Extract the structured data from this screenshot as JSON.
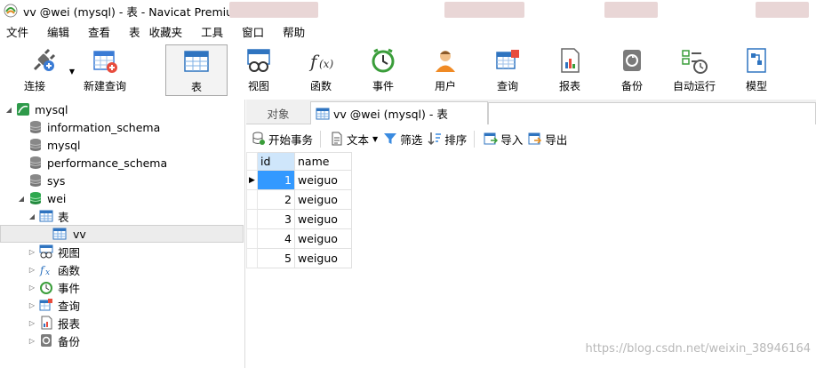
{
  "window": {
    "title": "vv @wei (mysql) - 表 - Navicat Premium"
  },
  "menu": [
    "文件",
    "编辑",
    "查看",
    "表",
    "收藏夹",
    "工具",
    "窗口",
    "帮助"
  ],
  "toolbar": {
    "connect": "连接",
    "new_query": "新建查询",
    "table": "表",
    "view": "视图",
    "function": "函数",
    "event": "事件",
    "user": "用户",
    "query": "查询",
    "report": "报表",
    "backup": "备份",
    "automation": "自动运行",
    "model": "模型"
  },
  "tree": {
    "connection": "mysql",
    "databases": [
      "information_schema",
      "mysql",
      "performance_schema",
      "sys"
    ],
    "active_db": "wei",
    "tables_node": "表",
    "table_item": "vv",
    "groups": [
      "视图",
      "函数",
      "事件",
      "查询",
      "报表",
      "备份"
    ]
  },
  "tabs": {
    "objects": "对象",
    "current": "vv @wei (mysql) - 表"
  },
  "subtoolbar": {
    "begin_txn": "开始事务",
    "text": "文本",
    "filter": "筛选",
    "sort": "排序",
    "import": "导入",
    "export": "导出"
  },
  "grid": {
    "columns": [
      "id",
      "name"
    ],
    "rows": [
      {
        "id": "1",
        "name": "weiguo"
      },
      {
        "id": "2",
        "name": "weiguo"
      },
      {
        "id": "3",
        "name": "weiguo"
      },
      {
        "id": "4",
        "name": "weiguo"
      },
      {
        "id": "5",
        "name": "weiguo"
      }
    ]
  },
  "watermark": "https://blog.csdn.net/weixin_38946164",
  "colors": {
    "selection": "#3399ff",
    "header_selected": "#cfe6fb",
    "db_active": "#28a745"
  }
}
